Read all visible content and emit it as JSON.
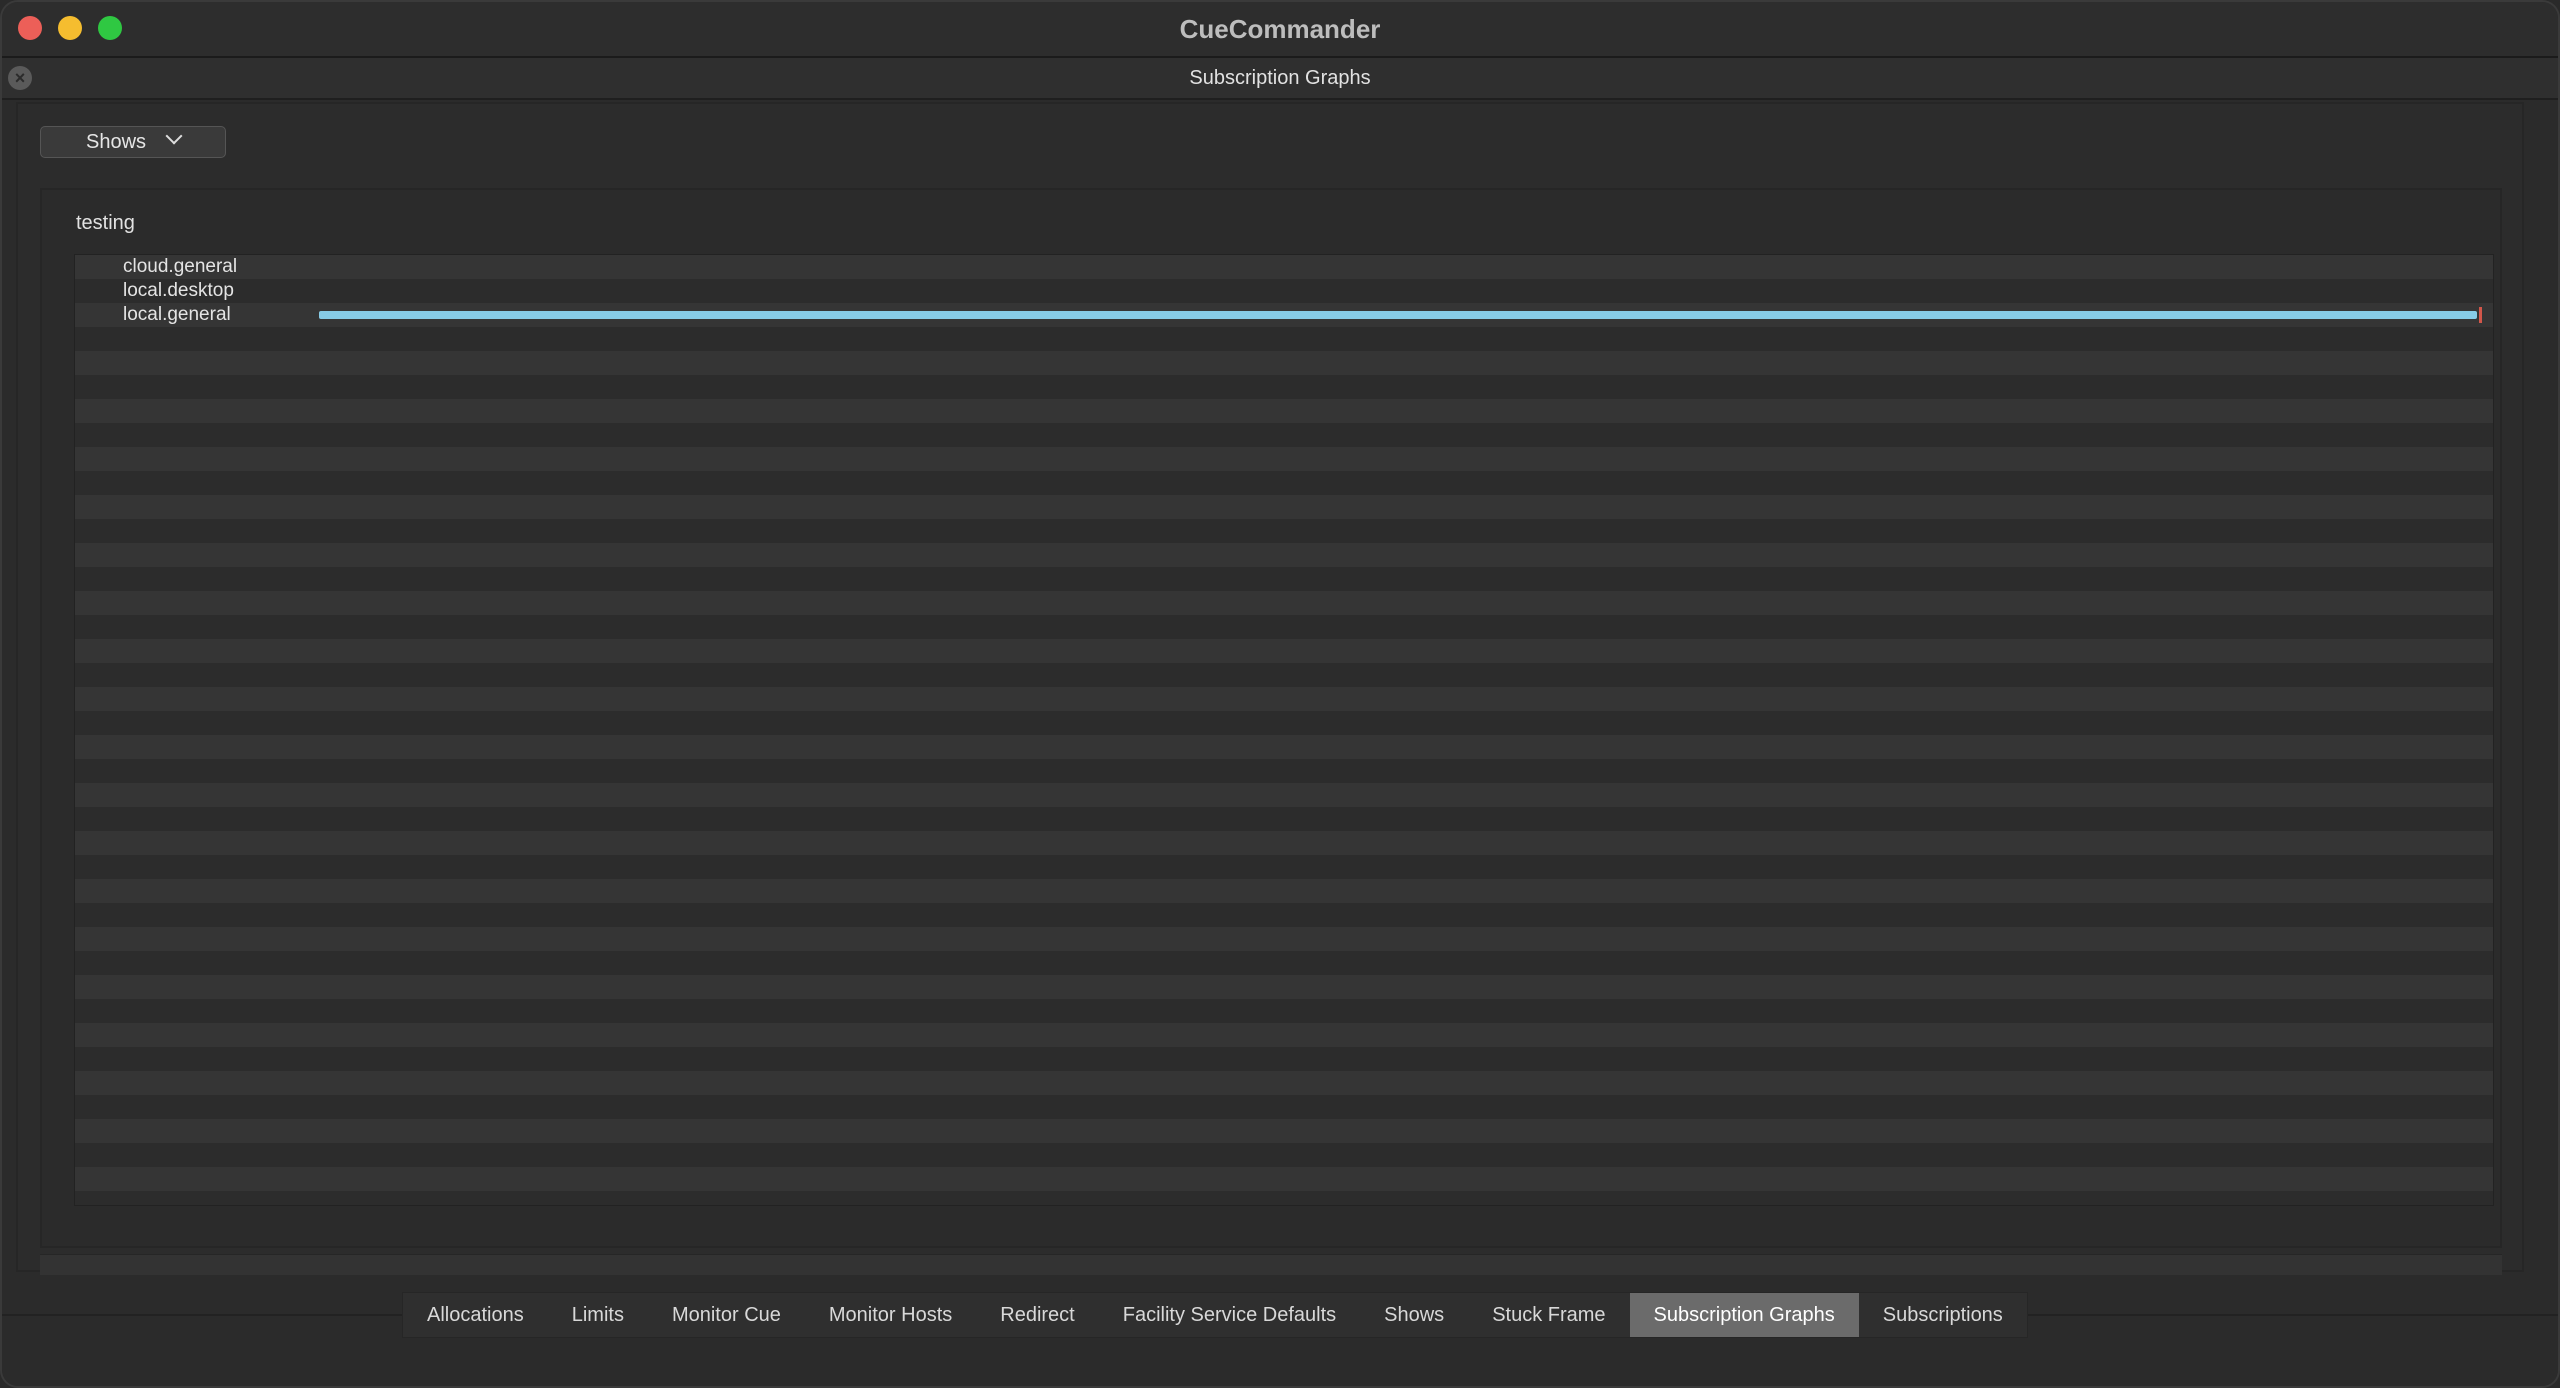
{
  "window": {
    "title": "CueCommander"
  },
  "dock": {
    "title": "Subscription Graphs"
  },
  "dropdown": {
    "selected": "Shows"
  },
  "group": {
    "title": "testing",
    "subscriptions": [
      {
        "label": "cloud.general",
        "usage_fraction": 0.0,
        "has_bar": false
      },
      {
        "label": "local.desktop",
        "usage_fraction": 0.0,
        "has_bar": false
      },
      {
        "label": "local.general",
        "usage_fraction": 0.998,
        "has_bar": true
      }
    ]
  },
  "colors": {
    "bar": "#87cbe6",
    "limit_marker": "#d2564a",
    "active_tab": "#6b6b6b"
  },
  "tabs": [
    {
      "label": "Allocations",
      "active": false
    },
    {
      "label": "Limits",
      "active": false
    },
    {
      "label": "Monitor Cue",
      "active": false
    },
    {
      "label": "Monitor Hosts",
      "active": false
    },
    {
      "label": "Redirect",
      "active": false
    },
    {
      "label": "Facility Service Defaults",
      "active": false
    },
    {
      "label": "Shows",
      "active": false
    },
    {
      "label": "Stuck Frame",
      "active": false
    },
    {
      "label": "Subscription Graphs",
      "active": true
    },
    {
      "label": "Subscriptions",
      "active": false
    }
  ]
}
